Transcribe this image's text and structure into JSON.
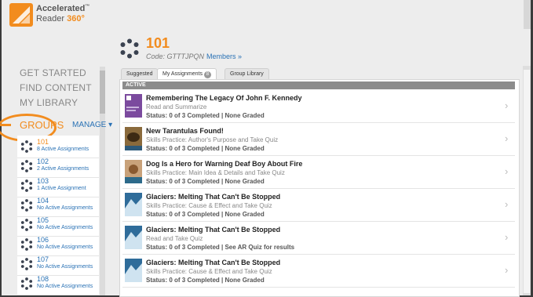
{
  "app": {
    "brand_line1": "Accelerated",
    "brand_line2a": "Reader ",
    "brand_line2b": "360°",
    "brand_tm": "™"
  },
  "group": {
    "number": "101",
    "code": "Code: GTTTJPQN",
    "members": "Members »"
  },
  "nav": [
    "GET STARTED",
    "FIND CONTENT",
    "MY LIBRARY"
  ],
  "groups_panel": {
    "title": "GROUPS",
    "manage": "MANAGE ▾",
    "items": [
      {
        "name": "101",
        "sub": "8 Active Assignments"
      },
      {
        "name": "102",
        "sub": "2 Active Assignments"
      },
      {
        "name": "103",
        "sub": "1 Active Assignment"
      },
      {
        "name": "104",
        "sub": "No Active Assignments"
      },
      {
        "name": "105",
        "sub": "No Active Assignments"
      },
      {
        "name": "106",
        "sub": "No Active Assignments"
      },
      {
        "name": "107",
        "sub": "No Active Assignments"
      },
      {
        "name": "108",
        "sub": "No Active Assignments"
      }
    ]
  },
  "tabs": {
    "suggested": "Suggested",
    "my_assignments": "My Assignments",
    "badge": "8",
    "library": "Group Library"
  },
  "section": "ACTIVE",
  "assignments": [
    {
      "title": "Remembering The Legacy Of John F. Kennedy",
      "sub": "Read and Summarize",
      "status": "Status: 0 of 3 Completed | None Graded"
    },
    {
      "title": "New Tarantulas Found!",
      "sub": "Skills Practice: Author's Purpose and Take Quiz",
      "status": "Status: 0 of 3 Completed | None Graded"
    },
    {
      "title": "Dog Is a Hero for Warning Deaf Boy About Fire",
      "sub": "Skills Practice: Main Idea & Details and Take Quiz",
      "status": "Status: 0 of 3 Completed | None Graded"
    },
    {
      "title": "Glaciers: Melting That Can't Be Stopped",
      "sub": "Skills Practice: Cause & Effect and Take Quiz",
      "status": "Status: 0 of 3 Completed | None Graded"
    },
    {
      "title": "Glaciers: Melting That Can't Be Stopped",
      "sub": "Read and Take Quiz",
      "status": "Status: 0 of 3 Completed | See AR Quiz for results"
    },
    {
      "title": "Glaciers: Melting That Can't Be Stopped",
      "sub": "Skills Practice: Cause & Effect and Take Quiz",
      "status": "Status: 0 of 3 Completed | None Graded"
    }
  ]
}
